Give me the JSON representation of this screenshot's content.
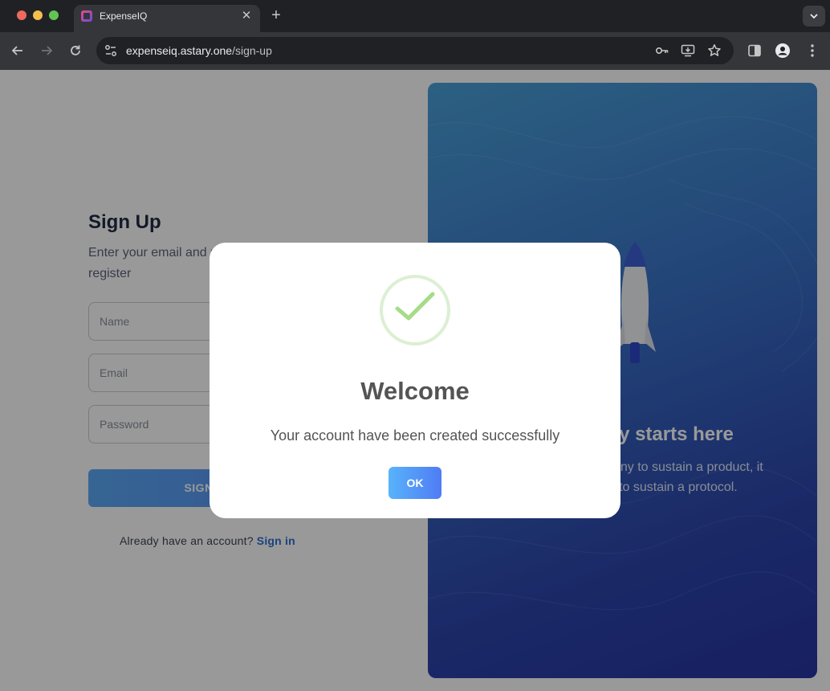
{
  "browser": {
    "tab_title": "ExpenseIQ",
    "tab_close": "✕",
    "new_tab": "+",
    "url_domain": "expenseiq.astary.one",
    "url_path": "/sign-up"
  },
  "signup": {
    "title": "Sign Up",
    "subtitle": "Enter your email and password to register",
    "name_placeholder": "Name",
    "email_placeholder": "Email",
    "password_placeholder": "Password",
    "button_label": "SIGN UP",
    "already_text": "Already have an account?",
    "signin_link": "Sign in"
  },
  "hero": {
    "title": "Your journey starts here",
    "text": "Just as it takes a company to sustain a product, it takes a community to sustain a protocol."
  },
  "modal": {
    "title": "Welcome",
    "message": "Your account have been created successfully",
    "ok_label": "OK",
    "icon": "check-icon"
  },
  "colors": {
    "accent": "#4f7cf5",
    "success": "#a5dc86",
    "link": "#2d6fd3"
  }
}
